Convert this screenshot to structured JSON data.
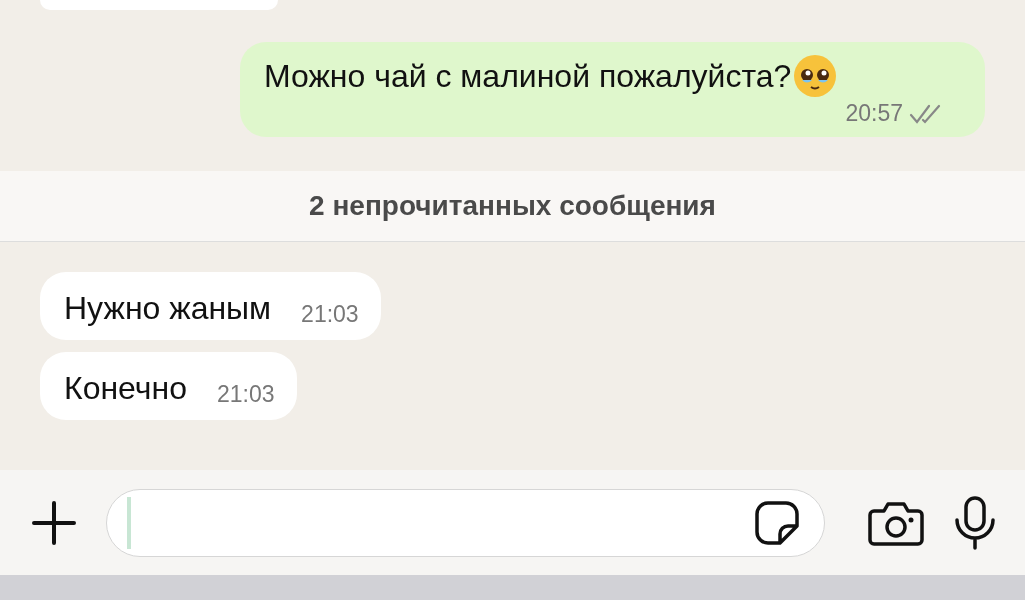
{
  "messages": [
    {
      "kind": "fragment"
    },
    {
      "kind": "outgoing",
      "text": "Можно чай с малиной пожалуйста?",
      "emoji": true,
      "time": "20:57",
      "read": false
    },
    {
      "kind": "banner",
      "text": "2 непрочитанных сообщения"
    },
    {
      "kind": "incoming",
      "text": "Нужно жаным",
      "emoji": false,
      "time": "21:03"
    },
    {
      "kind": "incoming",
      "text": "Конечно",
      "emoji": false,
      "time": "21:03"
    }
  ]
}
